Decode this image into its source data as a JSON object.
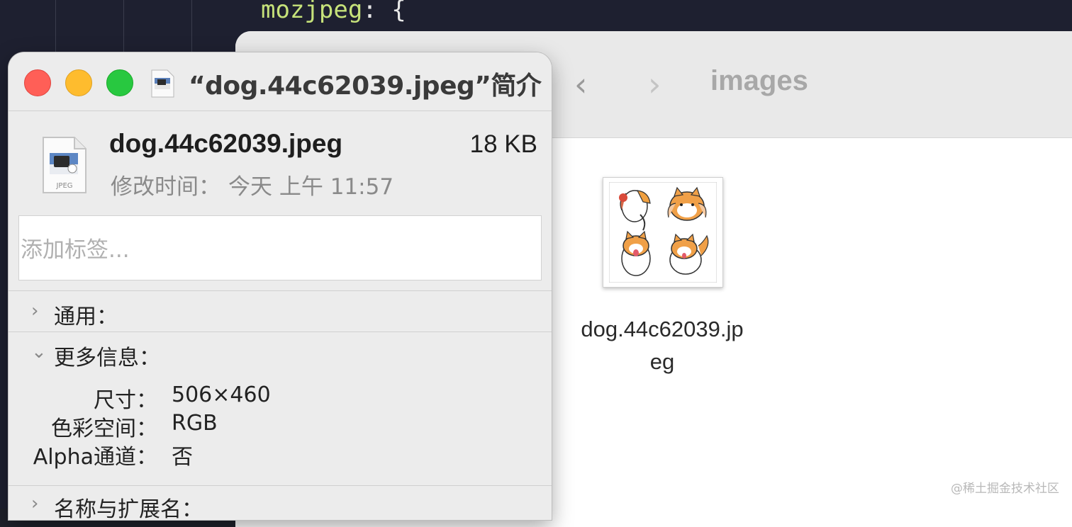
{
  "editor": {
    "code_key": "mozjpeg",
    "code_punct": ": {"
  },
  "finder": {
    "back_glyph": "‹",
    "forward_glyph": "›",
    "folder_title": "images",
    "file_label_line1": "dog.44c62039.jp",
    "file_label_line2": "eg",
    "thumbnail_icon": "dog-sticker-thumbnail"
  },
  "info_window": {
    "title": "“dog.44c62039.jpeg”简介",
    "file_name": "dog.44c62039.jpeg",
    "file_size": "18 KB",
    "file_type_badge": "JPEG",
    "modified_label": "修改时间：",
    "modified_value": "今天 上午 11:57",
    "tags_placeholder": "添加标签...",
    "sections": {
      "general": "通用：",
      "more_info": "更多信息：",
      "name_ext": "名称与扩展名："
    },
    "more_info": {
      "dimensions_label": "尺寸：",
      "dimensions_value": "506×460",
      "color_space_label": "色彩空间：",
      "color_space_value": "RGB",
      "alpha_label": "Alpha通道：",
      "alpha_value": "否"
    }
  },
  "watermark": "@稀土掘金技术社区",
  "colors": {
    "close": "#ff5f57",
    "minimize": "#febc2e",
    "zoom": "#28c840",
    "code_key": "#c6e27a"
  }
}
